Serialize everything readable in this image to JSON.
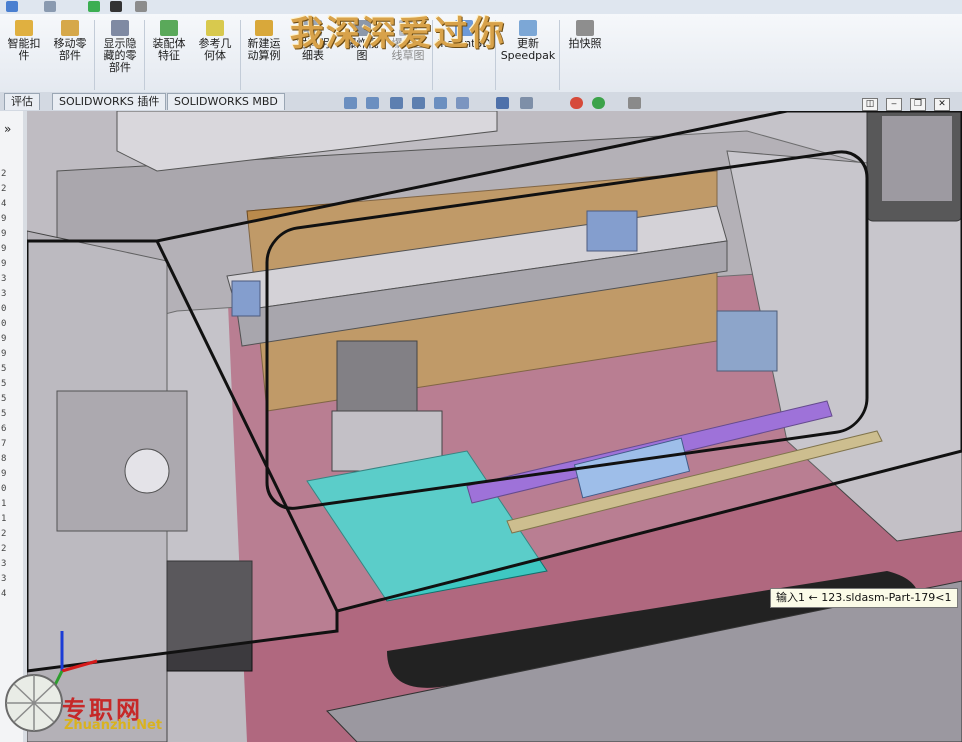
{
  "watermark_text": "我深深爱过你",
  "ribbon": {
    "buttons": [
      {
        "id": "smart-fastener",
        "label": "智能扣\n件",
        "icon": "smart-fastener-icon"
      },
      {
        "id": "move-component",
        "label": "移动零\n部件",
        "icon": "move-component-icon"
      },
      {
        "id": "show-hidden",
        "label": "显示隐\n藏的零\n部件",
        "icon": "show-hidden-icon"
      },
      {
        "id": "assembly-feature",
        "label": "装配体\n特征",
        "icon": "assembly-feature-icon"
      },
      {
        "id": "reference-geometry",
        "label": "参考几\n何体",
        "icon": "reference-geometry-icon"
      },
      {
        "id": "new-motion-study",
        "label": "新建运\n动算例",
        "icon": "motion-study-icon"
      },
      {
        "id": "bill-of-materials",
        "label": "材料明\n细表",
        "icon": "bom-icon"
      },
      {
        "id": "exploded-view",
        "label": "爆炸视\n图",
        "icon": "exploded-view-icon"
      },
      {
        "id": "explode-line-sketch",
        "label": "爆炸直\n线草图",
        "icon": "explode-line-icon"
      },
      {
        "id": "instant3d",
        "label": "Instant3D",
        "icon": "instant3d-icon"
      },
      {
        "id": "update-speedpak",
        "label": "更新\nSpeedpak",
        "icon": "speedpak-icon"
      },
      {
        "id": "snapshot",
        "label": "拍快照",
        "icon": "snapshot-icon"
      }
    ]
  },
  "tabs": [
    "评估",
    "SOLIDWORKS 插件",
    "SOLIDWORKS MBD"
  ],
  "left_panel": {
    "collapse_glyph": "»",
    "ticks": [
      "2",
      "2",
      "4",
      "9",
      "9",
      "9",
      "9",
      "3",
      "3",
      "0",
      "0",
      "9",
      "9",
      "5",
      "5",
      "5",
      "5",
      "6",
      "7",
      "8",
      "9",
      "0",
      "1",
      "1",
      "2",
      "2",
      "3",
      "3",
      "4"
    ]
  },
  "window_controls": [
    "◫",
    "‒",
    "❐",
    "✕"
  ],
  "tooltip": "输入1 ← 123.sldasm-Part-179<1",
  "site_logo": {
    "name": "专职网",
    "url": "Zhuanzhi.Net"
  },
  "colors": {
    "pink_floor": "#b0687f",
    "metal": "#a9a6ab",
    "rail_blue": "#6f8fc9",
    "teal": "#3ec8c2",
    "purple_rod": "#8f5ad6",
    "amber_panel": "#b98a4c",
    "watermark": "#d8a24a"
  }
}
